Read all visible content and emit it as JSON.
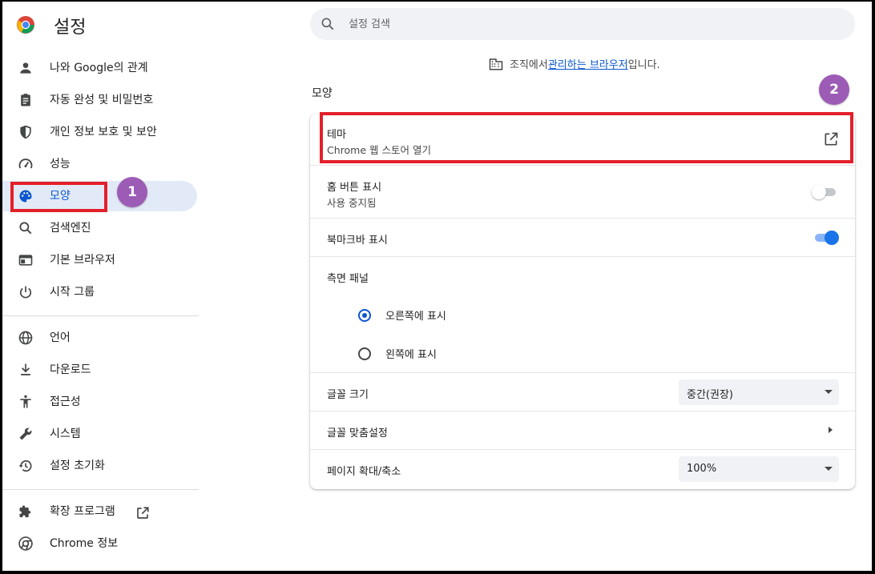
{
  "app": {
    "title": "설정"
  },
  "search": {
    "placeholder": "설정 검색"
  },
  "sidebar": {
    "items": [
      {
        "label": "나와 Google의 관계",
        "icon": "person-icon"
      },
      {
        "label": "자동 완성 및 비밀번호",
        "icon": "clipboard-icon"
      },
      {
        "label": "개인 정보 보호 및 보안",
        "icon": "shield-icon"
      },
      {
        "label": "성능",
        "icon": "speedometer-icon"
      },
      {
        "label": "모양",
        "icon": "palette-icon",
        "active": true
      },
      {
        "label": "검색엔진",
        "icon": "search-icon"
      },
      {
        "label": "기본 브라우저",
        "icon": "browser-window-icon"
      },
      {
        "label": "시작 그룹",
        "icon": "power-icon"
      },
      {
        "label": "언어",
        "icon": "globe-icon"
      },
      {
        "label": "다운로드",
        "icon": "download-icon"
      },
      {
        "label": "접근성",
        "icon": "accessibility-icon"
      },
      {
        "label": "시스템",
        "icon": "wrench-icon"
      },
      {
        "label": "설정 초기화",
        "icon": "history-icon"
      },
      {
        "label": "확장 프로그램",
        "icon": "puzzle-icon"
      },
      {
        "label": "Chrome 정보",
        "icon": "chrome-icon"
      }
    ]
  },
  "managed": {
    "prefix": "조직에서 ",
    "link": "관리하는 브라우저",
    "suffix": "입니다."
  },
  "section": {
    "title": "모양"
  },
  "appearance": {
    "theme": {
      "label": "테마",
      "sub": "Chrome 웹 스토어 열기"
    },
    "home_button": {
      "label": "홈 버튼 표시",
      "sub": "사용 중지됨",
      "on": false
    },
    "bookmarks_bar": {
      "label": "북마크바 표시",
      "on": true
    },
    "side_panel": {
      "label": "측면 패널",
      "options": [
        {
          "label": "오른쪽에 표시",
          "checked": true
        },
        {
          "label": "왼쪽에 표시",
          "checked": false
        }
      ]
    },
    "font_size": {
      "label": "글꼴 크기",
      "value": "중간(권장)"
    },
    "custom_fonts": {
      "label": "글꼴 맞춤설정"
    },
    "page_zoom": {
      "label": "페이지 확대/축소",
      "value": "100%"
    }
  },
  "annotations": {
    "badge1": "1",
    "badge2": "2",
    "color": "#e3202a",
    "badge_color": "#9c5bb5"
  },
  "colors": {
    "accent": "#0b57d0",
    "active_bg": "#e3eaf7",
    "search_bg": "#f0f2f5"
  }
}
